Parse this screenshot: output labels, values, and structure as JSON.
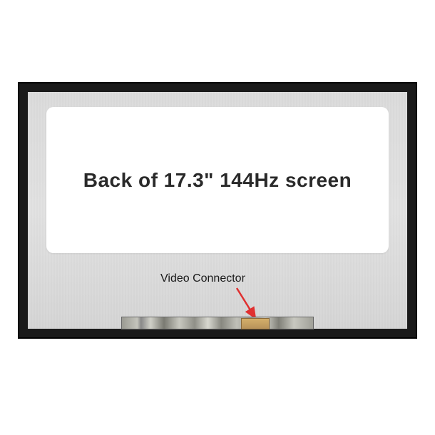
{
  "labels": {
    "main_text": "Back of 17.3\" 144Hz screen",
    "connector_label": "Video Connector"
  }
}
